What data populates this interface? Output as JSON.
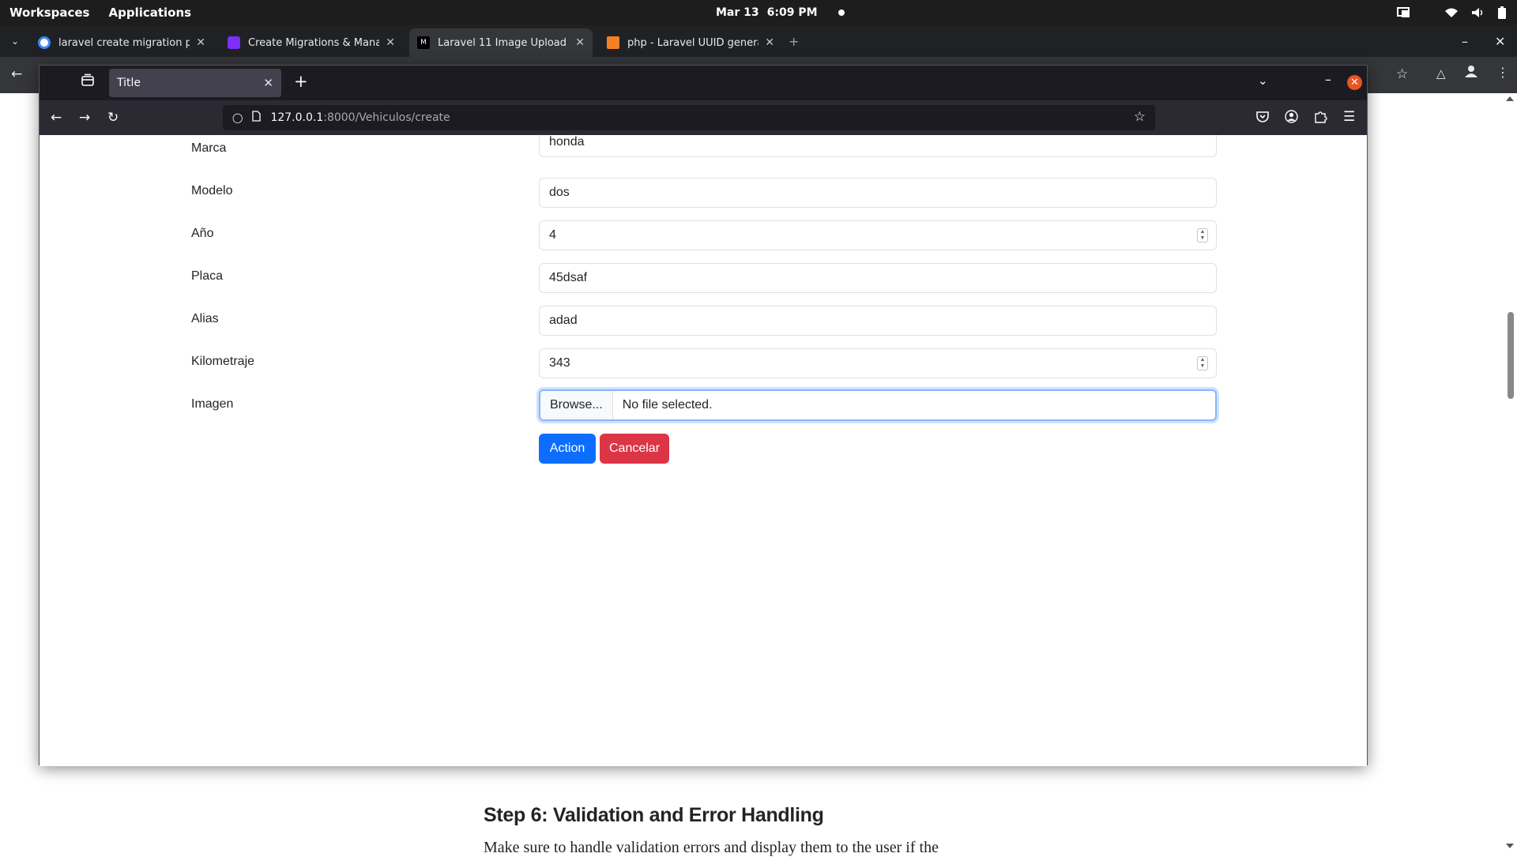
{
  "topbar": {
    "workspaces": "Workspaces",
    "applications": "Applications",
    "date": "Mar 13",
    "time": "6:09 PM"
  },
  "chrome": {
    "tabs": [
      {
        "title": "laravel create migration pat",
        "favicon_color": "#4285f4",
        "active": false
      },
      {
        "title": "Create Migrations & Manage",
        "favicon_color": "#7b2ff7",
        "active": false
      },
      {
        "title": "Laravel 11 Image Upload Exa",
        "favicon_color": "#ffffff",
        "active": true
      },
      {
        "title": "php - Laravel UUID generatio",
        "favicon_color": "#f48024",
        "active": false
      }
    ],
    "new_tab": "+"
  },
  "article": {
    "heading": "Step 6: Validation and Error Handling",
    "paragraph": "Make sure to handle validation errors and display them to the user if the"
  },
  "firefox": {
    "tab_title": "Title",
    "url_host": "127.0.0.1",
    "url_path": ":8000/Vehiculos/create",
    "accent_close": "#e95420"
  },
  "form": {
    "fields": [
      {
        "label": "Marca",
        "value": "honda",
        "type": "text"
      },
      {
        "label": "Modelo",
        "value": "dos",
        "type": "text"
      },
      {
        "label": "Año",
        "value": "4",
        "type": "number"
      },
      {
        "label": "Placa",
        "value": "45dsaf",
        "type": "text"
      },
      {
        "label": "Alias",
        "value": "adad",
        "type": "text"
      },
      {
        "label": "Kilometraje",
        "value": "343",
        "type": "number"
      }
    ],
    "image": {
      "label": "Imagen",
      "browse": "Browse...",
      "status": "No file selected."
    },
    "action_button": "Action",
    "cancel_button": "Cancelar",
    "colors": {
      "primary": "#0d6efd",
      "danger": "#dc3545"
    }
  }
}
